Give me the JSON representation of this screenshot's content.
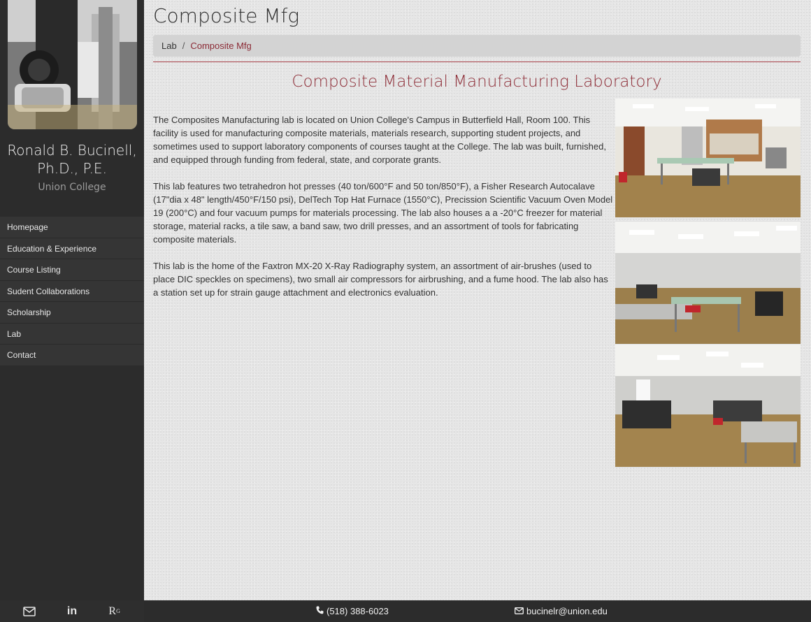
{
  "profile": {
    "name_line1": "Ronald B. Bucinell,",
    "name_line2": "Ph.D., P.E.",
    "organization": "Union College"
  },
  "nav": {
    "items": [
      {
        "label": "Homepage"
      },
      {
        "label": "Education & Experience"
      },
      {
        "label": "Course Listing"
      },
      {
        "label": "Sudent Collaborations"
      },
      {
        "label": "Scholarship"
      },
      {
        "label": "Lab"
      },
      {
        "label": "Contact"
      }
    ]
  },
  "sidebar_footer": {
    "icons": [
      "envelope-icon",
      "linkedin-icon",
      "researchgate-icon"
    ],
    "researchgate_label": "R",
    "researchgate_sup": "G",
    "linkedin_label": "in"
  },
  "page": {
    "title": "Composite Mfg",
    "breadcrumb": {
      "first": "Lab",
      "separator": "/",
      "current": "Composite Mfg"
    },
    "heading": "Composite Material Manufacturing Laboratory",
    "paragraphs": [
      "The Composites Manufacturing lab is located on Union College's Campus in Butterfield Hall, Room 100. This facility is used for manufacturing composite materials, materials research, supporting student projects, and sometimes used to support laboratory components of courses taught at the College. The lab was built, furnished, and equipped through funding from federal, state, and corporate grants.",
      "This lab features two tetrahedron hot presses (40 ton/600°F and 50 ton/850°F), a Fisher Research Autocalave (17\"dia x 48\" length/450°F/150 psi), DelTech Top Hat Furnace (1550°C), Precission Scientific Vacuum Oven Model 19 (200°C) and four vacuum pumps for materials processing. The lab also houses a a -20°C freezer for material storage, material racks, a tile saw, a band saw, two drill presses, and an assortment of tools for fabricating composite materials.",
      "This lab is the home of the Faxtron MX-20 X-Ray Radiography system, an assortment of air-brushes (used to place DIC speckles on specimens), two small air compressors for airbrushing, and a fume hood. The lab also has a station set up for strain gauge attachment and electronics evaluation."
    ]
  },
  "footer": {
    "phone": "(518) 388-6023",
    "email": "bucinelr@union.edu"
  },
  "colors": {
    "accent": "#8e2e38",
    "sidebar": "#2c2c2c"
  }
}
